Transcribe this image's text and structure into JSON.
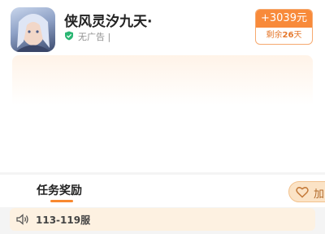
{
  "app": {
    "title": "侠风灵汐九天·",
    "no_ads_label": "无广告 |",
    "icon_badge": "",
    "icon_name": "game-icon"
  },
  "reward": {
    "amount": "+3039元",
    "days_prefix": "剩余",
    "days_value": "26",
    "days_suffix": "天"
  },
  "tabs": [
    {
      "label": "任务奖励",
      "active": true
    }
  ],
  "favorite": {
    "label": "加",
    "icon": "heart-icon"
  },
  "notice": {
    "icon": "speaker-icon",
    "text": "113-119服"
  },
  "colors": {
    "accent": "#f88a3a",
    "accent_text": "#e5772b",
    "notice_bg": "#fdf1e1"
  }
}
